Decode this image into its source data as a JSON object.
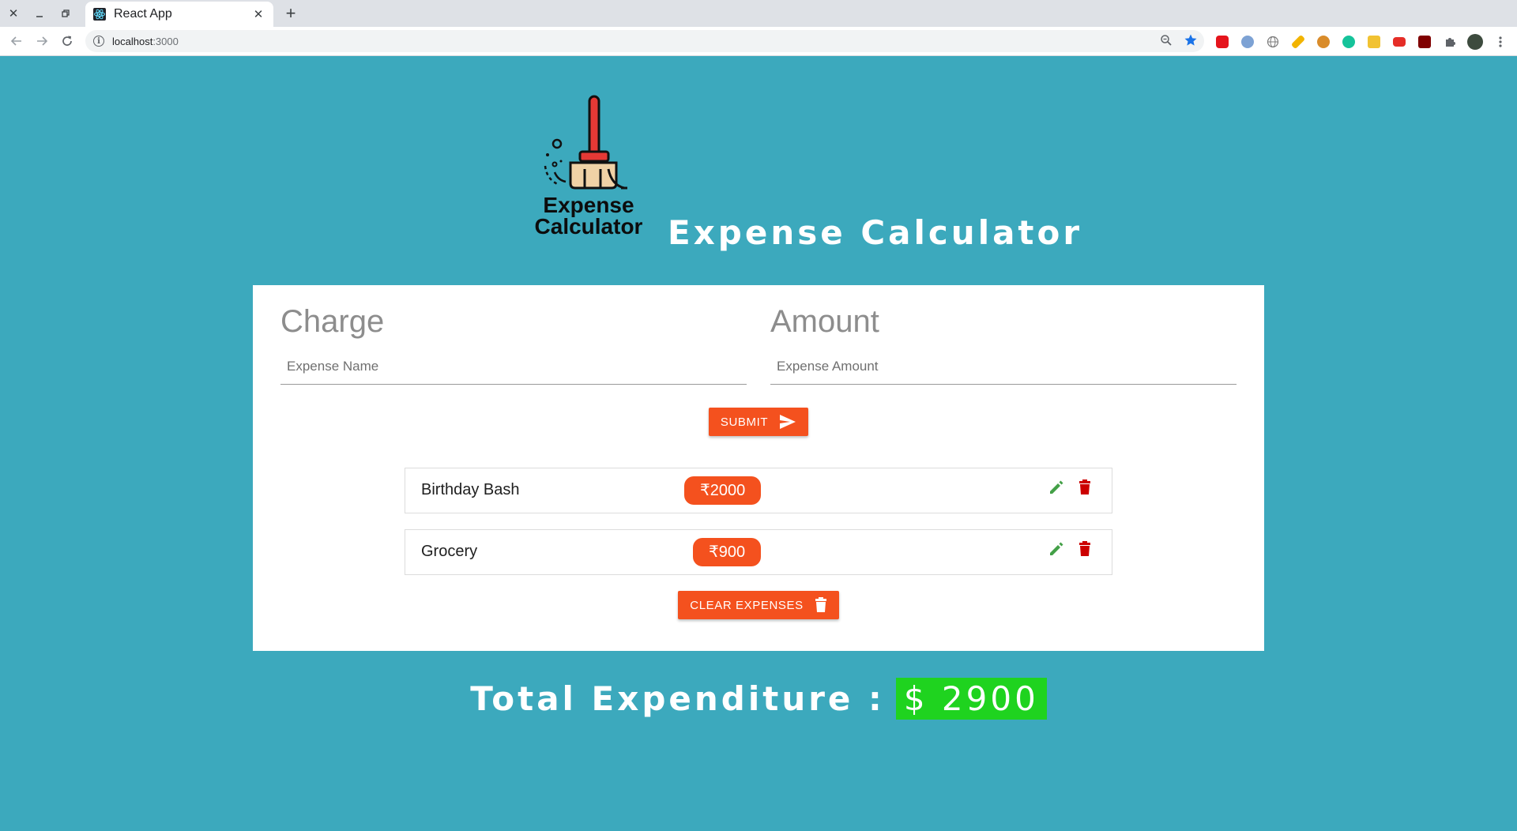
{
  "browser": {
    "tab_title": "React App",
    "url_host": "localhost",
    "url_port": ":3000",
    "extension_icons": [
      "adblock-icon",
      "privacy-icon",
      "globe-icon",
      "pencil-ext-icon",
      "cookie-icon",
      "grammarly-icon",
      "vpn-icon",
      "youtube-icon",
      "ublock-icon",
      "puzzle-icon",
      "profile-avatar"
    ]
  },
  "header": {
    "logo_line1": "Expense",
    "logo_line2": "Calculator",
    "title": "Expense Calculator"
  },
  "form": {
    "charge_label": "Charge",
    "charge_placeholder": "Expense Name",
    "amount_label": "Amount",
    "amount_placeholder": "Expense Amount",
    "submit_label": "SUBMIT"
  },
  "expenses": [
    {
      "name": "Birthday Bash",
      "amount": "₹2000"
    },
    {
      "name": "Grocery",
      "amount": "₹900"
    }
  ],
  "clear_label": "CLEAR EXPENSES",
  "total": {
    "label": "Total Expenditure :",
    "value": "$ 2900"
  },
  "colors": {
    "page_bg": "#3ca9bd",
    "accent": "#f4511e",
    "edit_icon": "#43a047",
    "delete_icon": "#cc0000",
    "total_highlight": "#1fd31f"
  }
}
